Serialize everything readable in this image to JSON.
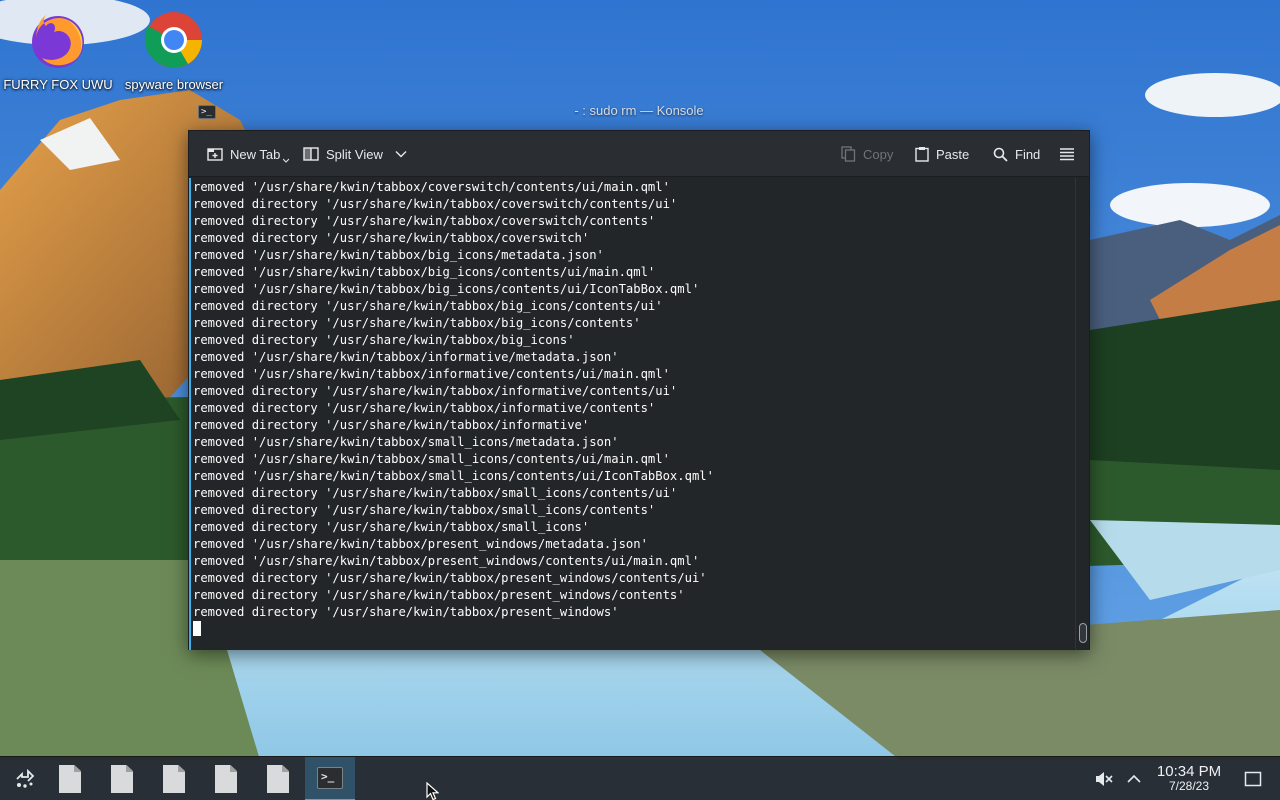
{
  "desktop": {
    "icons": [
      {
        "label": "FURRY FOX UWU",
        "icon": "firefox-icon"
      },
      {
        "label": "spyware browser",
        "icon": "chrome-icon"
      }
    ]
  },
  "window": {
    "title": "- : sudo rm — Konsole",
    "app_icon_glyph": ">_"
  },
  "toolbar": {
    "new_tab_label": "New Tab",
    "split_view_label": "Split View",
    "copy_label": "Copy",
    "paste_label": "Paste",
    "find_label": "Find"
  },
  "terminal": {
    "lines": [
      "removed '/usr/share/kwin/tabbox/coverswitch/contents/ui/main.qml'",
      "removed directory '/usr/share/kwin/tabbox/coverswitch/contents/ui'",
      "removed directory '/usr/share/kwin/tabbox/coverswitch/contents'",
      "removed directory '/usr/share/kwin/tabbox/coverswitch'",
      "removed '/usr/share/kwin/tabbox/big_icons/metadata.json'",
      "removed '/usr/share/kwin/tabbox/big_icons/contents/ui/main.qml'",
      "removed '/usr/share/kwin/tabbox/big_icons/contents/ui/IconTabBox.qml'",
      "removed directory '/usr/share/kwin/tabbox/big_icons/contents/ui'",
      "removed directory '/usr/share/kwin/tabbox/big_icons/contents'",
      "removed directory '/usr/share/kwin/tabbox/big_icons'",
      "removed '/usr/share/kwin/tabbox/informative/metadata.json'",
      "removed '/usr/share/kwin/tabbox/informative/contents/ui/main.qml'",
      "removed directory '/usr/share/kwin/tabbox/informative/contents/ui'",
      "removed directory '/usr/share/kwin/tabbox/informative/contents'",
      "removed directory '/usr/share/kwin/tabbox/informative'",
      "removed '/usr/share/kwin/tabbox/small_icons/metadata.json'",
      "removed '/usr/share/kwin/tabbox/small_icons/contents/ui/main.qml'",
      "removed '/usr/share/kwin/tabbox/small_icons/contents/ui/IconTabBox.qml'",
      "removed directory '/usr/share/kwin/tabbox/small_icons/contents/ui'",
      "removed directory '/usr/share/kwin/tabbox/small_icons/contents'",
      "removed directory '/usr/share/kwin/tabbox/small_icons'",
      "removed '/usr/share/kwin/tabbox/present_windows/metadata.json'",
      "removed '/usr/share/kwin/tabbox/present_windows/contents/ui/main.qml'",
      "removed directory '/usr/share/kwin/tabbox/present_windows/contents/ui'",
      "removed directory '/usr/share/kwin/tabbox/present_windows/contents'",
      "removed directory '/usr/share/kwin/tabbox/present_windows'"
    ]
  },
  "taskbar": {
    "items": [
      {
        "icon": "file-icon"
      },
      {
        "icon": "file-icon"
      },
      {
        "icon": "file-icon"
      },
      {
        "icon": "file-icon"
      },
      {
        "icon": "file-icon"
      },
      {
        "icon": "konsole-icon",
        "active": true
      }
    ],
    "terminal_glyph": ">_",
    "clock": {
      "time": "10:34 PM",
      "date": "7/28/23"
    }
  },
  "colors": {
    "accent": "#3daee9",
    "window_bg": "#232629",
    "toolbar_bg": "#2a2e32",
    "text": "#fcfcfc"
  }
}
